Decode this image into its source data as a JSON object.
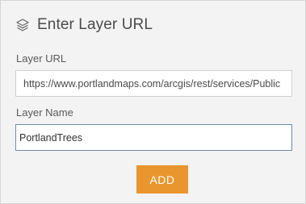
{
  "dialog": {
    "title": "Enter Layer URL",
    "header_icon": "layers-icon"
  },
  "fields": {
    "url_label": "Layer URL",
    "url_value": "https://www.portlandmaps.com/arcgis/rest/services/Public",
    "name_label": "Layer Name",
    "name_value": "PortlandTrees"
  },
  "actions": {
    "add_label": "ADD",
    "add_color": "#e9962f"
  }
}
